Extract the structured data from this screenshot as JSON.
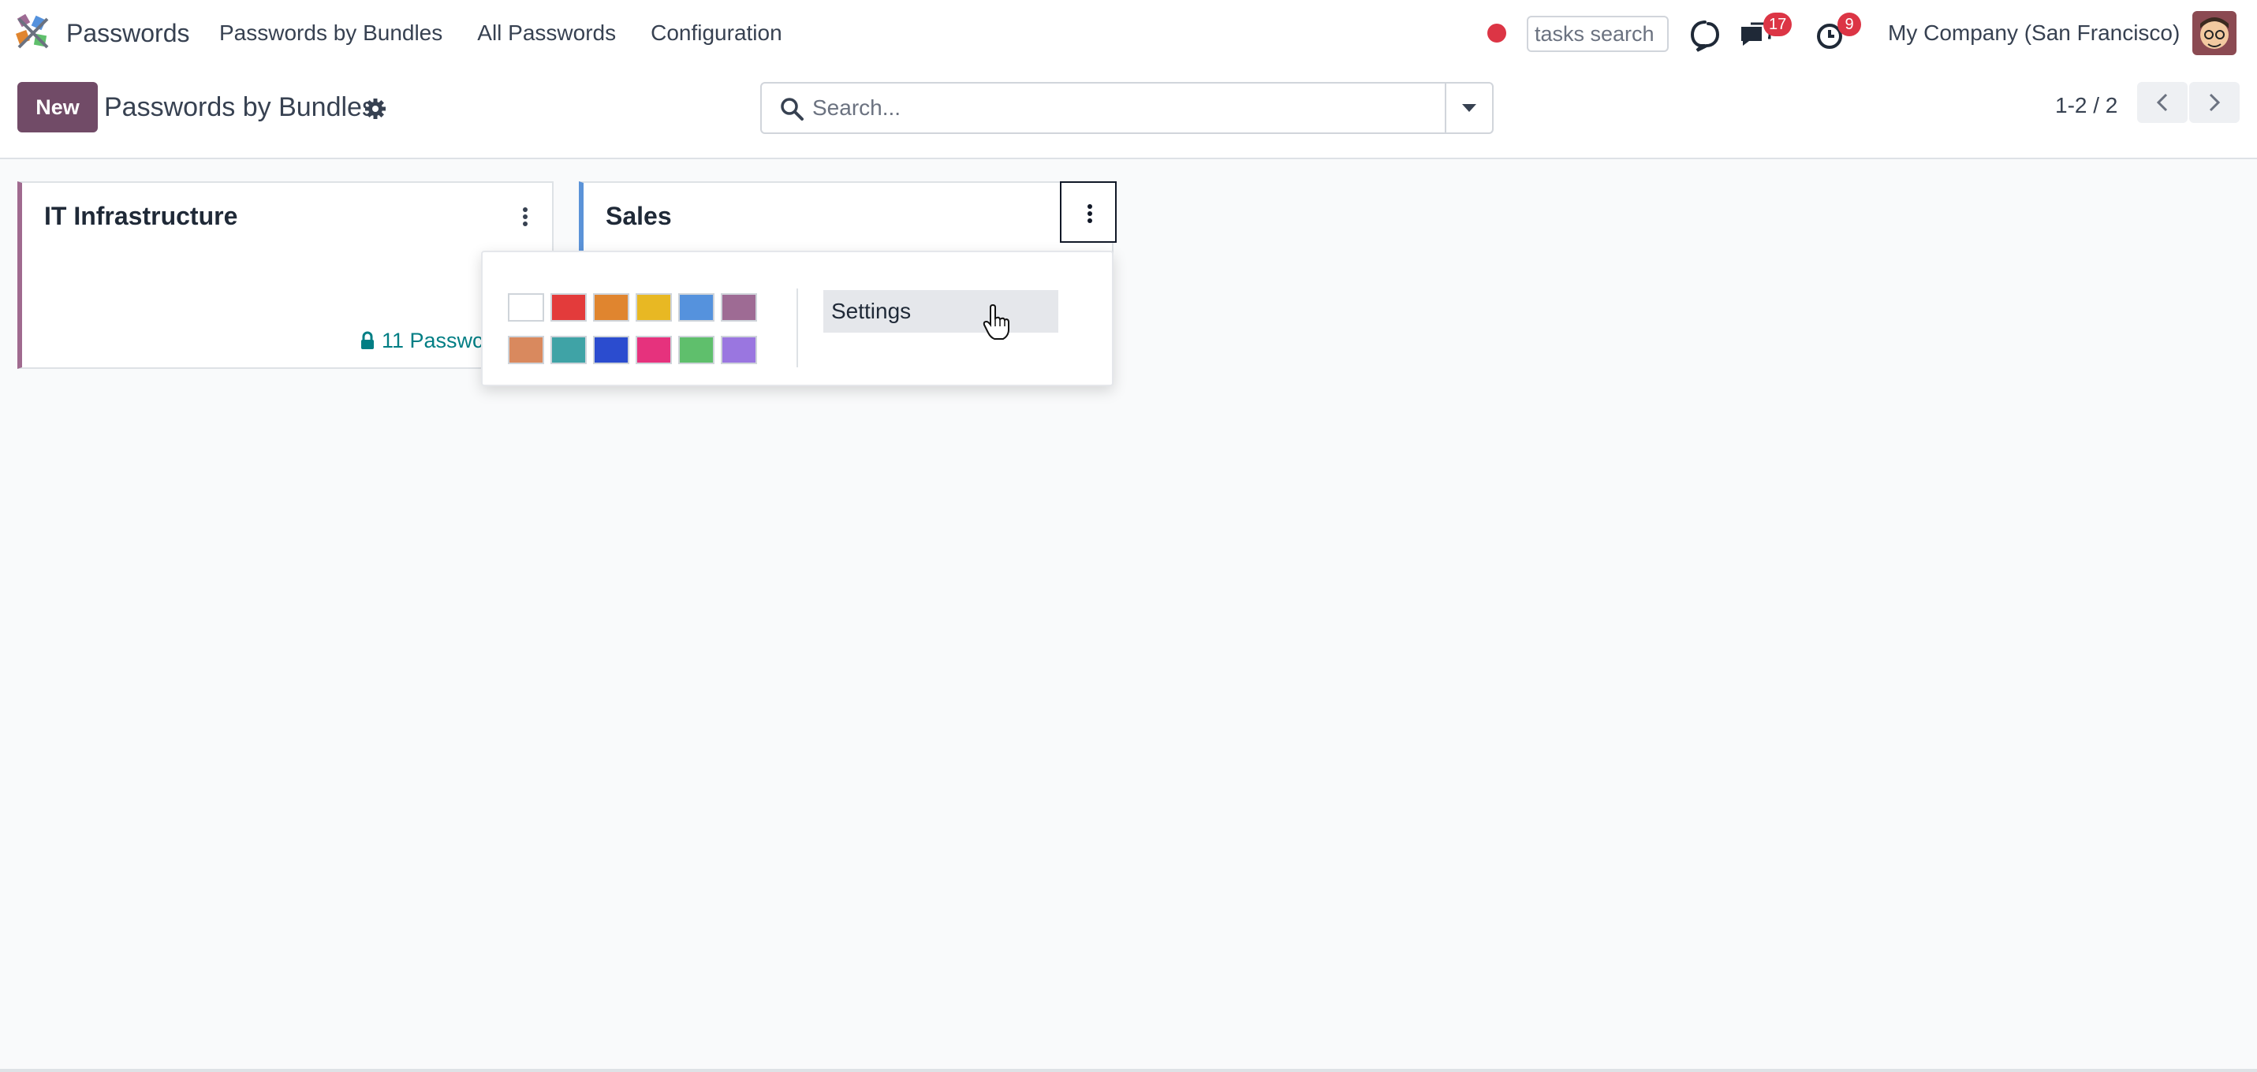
{
  "app": {
    "name": "Passwords",
    "logo_icon": "odoo-app-logo-icon"
  },
  "nav": {
    "items": [
      "Passwords by Bundles",
      "All Passwords",
      "Configuration"
    ]
  },
  "systray": {
    "tasks_search_placeholder": "tasks search",
    "messages_badge": "17",
    "activities_badge": "9",
    "company": "My Company (San Francisco)"
  },
  "control_panel": {
    "new_label": "New",
    "title": "Passwords by Bundles",
    "search_placeholder": "Search...",
    "pager": "1-2 / 2"
  },
  "cards": [
    {
      "title": "IT Infrastructure",
      "passwords_label": "11 Passwc",
      "color": "#a06a8f"
    },
    {
      "title": "Sales",
      "color": "#5b93d8"
    }
  ],
  "dropdown": {
    "colors": [
      "#ffffff",
      "#e33b3b",
      "#e0852f",
      "#e8b823",
      "#5592dd",
      "#9e6b94",
      "#d9895e",
      "#3fa3a6",
      "#2b4ccf",
      "#e6327d",
      "#5fbf6c",
      "#9a76e0"
    ],
    "settings_label": "Settings"
  }
}
